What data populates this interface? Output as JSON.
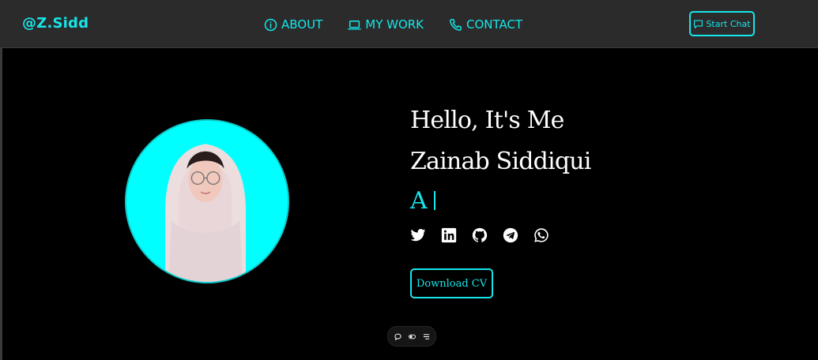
{
  "nav": {
    "logo": "@Z.Sidd",
    "links": [
      {
        "label": "ABOUT",
        "icon": "info-circle-icon"
      },
      {
        "label": "MY WORK",
        "icon": "laptop-icon"
      },
      {
        "label": "CONTACT",
        "icon": "phone-icon"
      }
    ],
    "chat_button": {
      "label": "Start Chat",
      "icon": "chat-bubble-icon"
    }
  },
  "hero": {
    "greeting": "Hello, It's Me",
    "name": "Zainab Siddiqui",
    "typed_text": "A",
    "socials": [
      "twitter-icon",
      "linkedin-icon",
      "github-icon",
      "telegram-icon",
      "whatsapp-icon"
    ],
    "cv_button": "Download CV"
  },
  "dock": {
    "icons": [
      "chat-icon",
      "toggle-icon",
      "menu-icon"
    ]
  },
  "colors": {
    "accent": "#16e6ea",
    "background": "#000000",
    "navbar": "#2b2b2b",
    "avatar_bg": "#00ffff"
  }
}
